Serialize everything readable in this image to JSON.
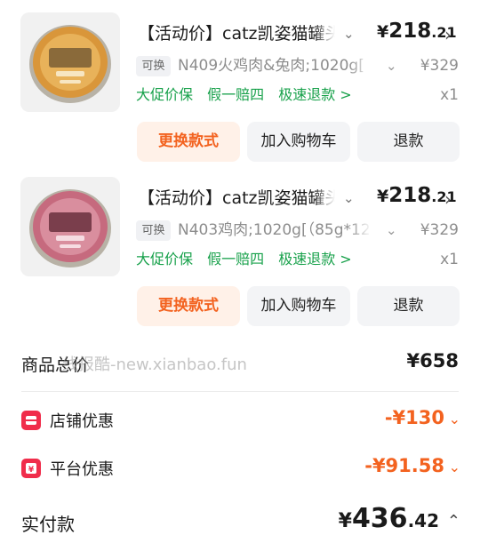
{
  "items": [
    {
      "title": "【活动价】catz凯姿猫罐头",
      "price_symbol": "¥",
      "price_int": "218",
      "price_dec": ".21",
      "swap_tag": "可换",
      "spec": "N409火鸡肉&兔肉;1020g[",
      "original_price": "¥329",
      "badges": [
        "大促价保",
        "假一赔四",
        "极速退款 >"
      ],
      "quantity": "x1",
      "buttons": {
        "change": "更换款式",
        "cart": "加入购物车",
        "refund": "退款"
      },
      "can_color": "#d9963a"
    },
    {
      "title": "【活动价】catz凯姿猫罐头",
      "price_symbol": "¥",
      "price_int": "218",
      "price_dec": ".21",
      "swap_tag": "可换",
      "spec": "N403鸡肉;1020g[（85g*12",
      "original_price": "¥329",
      "badges": [
        "大促价保",
        "假一赔四",
        "极速退款 >"
      ],
      "quantity": "x1",
      "buttons": {
        "change": "更换款式",
        "cart": "加入购物车",
        "refund": "退款"
      },
      "can_color": "#c66a7e"
    }
  ],
  "summary": {
    "total_label": "商品总价",
    "total_value": "¥658",
    "watermark": "线报酷-new.xianbao.fun",
    "shop_discount_label": "店铺优惠",
    "shop_discount_value": "-¥130",
    "platform_discount_label": "平台优惠",
    "platform_discount_value": "-¥91.58",
    "pay_label": "实付款",
    "pay_symbol": "¥",
    "pay_int": "436",
    "pay_dec": ".42"
  },
  "colors": {
    "accent": "#f3621f",
    "green": "#18a14b",
    "discount_icon": "#f02d4b"
  },
  "icons": [
    "chevron-down-icon",
    "chevron-right-icon",
    "shop-coupon-icon",
    "platform-coupon-icon",
    "chevron-up-icon"
  ]
}
